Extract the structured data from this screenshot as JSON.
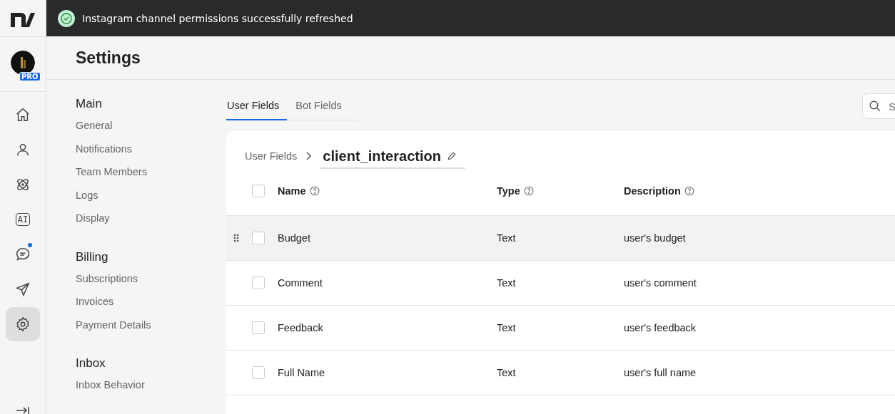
{
  "toast": {
    "message": "Instagram channel permissions successfully refreshed"
  },
  "account": {
    "badge": "PRO"
  },
  "rail": [
    {
      "kind": "home",
      "selected": false,
      "unread": false
    },
    {
      "kind": "user",
      "selected": false,
      "unread": false
    },
    {
      "kind": "atom",
      "selected": false,
      "unread": false
    },
    {
      "kind": "ai",
      "label": "AI",
      "selected": false,
      "unread": false
    },
    {
      "kind": "chat",
      "selected": false,
      "unread": true
    },
    {
      "kind": "send",
      "selected": false,
      "unread": false
    },
    {
      "kind": "gear",
      "selected": true,
      "unread": false
    }
  ],
  "page": {
    "title": "Settings"
  },
  "nav": [
    {
      "heading": "Main",
      "items": [
        "General",
        "Notifications",
        "Team Members",
        "Logs",
        "Display"
      ]
    },
    {
      "heading": "Billing",
      "items": [
        "Subscriptions",
        "Invoices",
        "Payment Details"
      ]
    },
    {
      "heading": "Inbox",
      "items": [
        "Inbox Behavior"
      ]
    }
  ],
  "tabs": [
    {
      "label": "User Fields",
      "selected": true
    },
    {
      "label": "Bot Fields",
      "selected": false
    }
  ],
  "search": {
    "placeholder": "S"
  },
  "breadcrumb": {
    "parent": "User Fields",
    "current": "client_interaction"
  },
  "table": {
    "all_checked": false,
    "columns": [
      "Name",
      "Type",
      "Description"
    ],
    "rows": [
      {
        "name": "Budget",
        "type": "Text",
        "description": "user's budget",
        "checked": false,
        "highlighted": true
      },
      {
        "name": "Comment",
        "type": "Text",
        "description": "user's comment",
        "checked": false,
        "highlighted": false
      },
      {
        "name": "Feedback",
        "type": "Text",
        "description": "user's feedback",
        "checked": false,
        "highlighted": false
      },
      {
        "name": "Full Name",
        "type": "Text",
        "description": "user's full name",
        "checked": false,
        "highlighted": false
      }
    ]
  }
}
